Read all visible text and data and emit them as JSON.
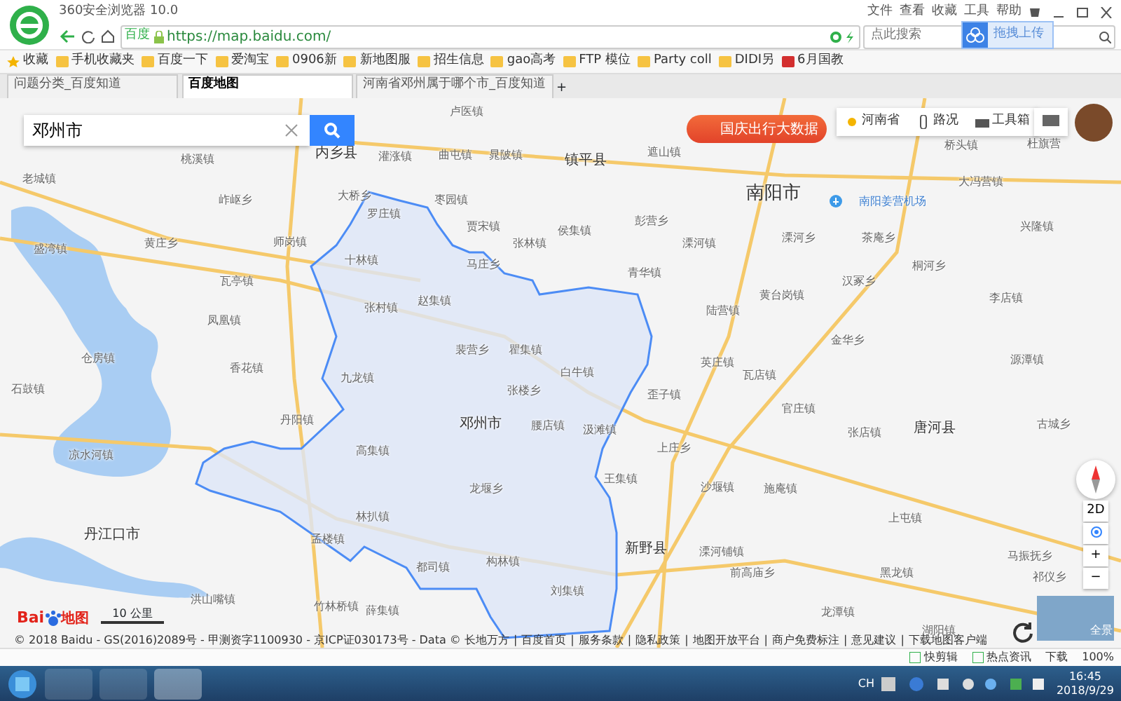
{
  "window": {
    "title": "360安全浏览器 10.0",
    "menu": [
      "文件",
      "查看",
      "收藏",
      "工具",
      "帮助"
    ]
  },
  "address_bar": {
    "site_badge": "百度",
    "url": "https://map.baidu.com/",
    "search_placeholder": "点此搜索",
    "upload_button": "拖拽上传"
  },
  "bookmarks": [
    "收藏",
    "手机收藏夹",
    "百度一下",
    "爱淘宝",
    "0906新",
    "新地图服",
    "招生信息",
    "gao高考",
    "FTP 模位",
    "Party coll",
    "DIDI另",
    "6月国教"
  ],
  "tabs": [
    {
      "label": "问题分类_百度知道",
      "selected": false
    },
    {
      "label": "百度地图",
      "selected": true
    },
    {
      "label": "河南省邓州属于哪个市_百度知道",
      "selected": false
    }
  ],
  "new_tab": "+",
  "map": {
    "search": {
      "value": "邓州市"
    },
    "banner": "国庆出行大数据",
    "toolbar": [
      "河南省",
      "路况",
      "工具箱"
    ],
    "labels": [
      {
        "text": "卢医镇",
        "kind": "town"
      },
      {
        "text": "内乡县",
        "kind": "county"
      },
      {
        "text": "桃溪镇",
        "kind": "town"
      },
      {
        "text": "灌涨镇",
        "kind": "town"
      },
      {
        "text": "曲屯镇",
        "kind": "town"
      },
      {
        "text": "晁陂镇",
        "kind": "town"
      },
      {
        "text": "老城镇",
        "kind": "town"
      },
      {
        "text": "岞岖乡",
        "kind": "town"
      },
      {
        "text": "大桥乡",
        "kind": "town"
      },
      {
        "text": "枣园镇",
        "kind": "town"
      },
      {
        "text": "罗庄镇",
        "kind": "town"
      },
      {
        "text": "贾宋镇",
        "kind": "town"
      },
      {
        "text": "盛湾镇",
        "kind": "town"
      },
      {
        "text": "黄庄乡",
        "kind": "town"
      },
      {
        "text": "师岗镇",
        "kind": "town"
      },
      {
        "text": "张林镇",
        "kind": "town"
      },
      {
        "text": "十林镇",
        "kind": "town"
      },
      {
        "text": "马庄乡",
        "kind": "town"
      },
      {
        "text": "瓦亭镇",
        "kind": "town"
      },
      {
        "text": "赵集镇",
        "kind": "town"
      },
      {
        "text": "张村镇",
        "kind": "town"
      },
      {
        "text": "凤凰镇",
        "kind": "town"
      },
      {
        "text": "裴营乡",
        "kind": "town"
      },
      {
        "text": "瞿集镇",
        "kind": "town"
      },
      {
        "text": "仓房镇",
        "kind": "town"
      },
      {
        "text": "香花镇",
        "kind": "town"
      },
      {
        "text": "九龙镇",
        "kind": "town"
      },
      {
        "text": "镇平县",
        "kind": "county"
      },
      {
        "text": "遮山镇",
        "kind": "town"
      },
      {
        "text": "南阳市",
        "kind": "city"
      },
      {
        "text": "桥头镇",
        "kind": "town"
      },
      {
        "text": "杜旗营",
        "kind": "town"
      },
      {
        "text": "大冯营镇",
        "kind": "town"
      },
      {
        "text": "彭营乡",
        "kind": "town"
      },
      {
        "text": "侯集镇",
        "kind": "town"
      },
      {
        "text": "溧河镇",
        "kind": "town"
      },
      {
        "text": "溧河乡",
        "kind": "town"
      },
      {
        "text": "茶庵乡",
        "kind": "town"
      },
      {
        "text": "兴隆镇",
        "kind": "town"
      },
      {
        "text": "青华镇",
        "kind": "town"
      },
      {
        "text": "桐河乡",
        "kind": "town"
      },
      {
        "text": "汉冢乡",
        "kind": "town"
      },
      {
        "text": "黄台岗镇",
        "kind": "town"
      },
      {
        "text": "陆营镇",
        "kind": "town"
      },
      {
        "text": "李店镇",
        "kind": "town"
      },
      {
        "text": "金华乡",
        "kind": "town"
      },
      {
        "text": "英庄镇",
        "kind": "town"
      },
      {
        "text": "源潭镇",
        "kind": "town"
      },
      {
        "text": "白牛镇",
        "kind": "town"
      },
      {
        "text": "瓦店镇",
        "kind": "town"
      },
      {
        "text": "石鼓镇",
        "kind": "town"
      },
      {
        "text": "张楼乡",
        "kind": "town"
      },
      {
        "text": "歪子镇",
        "kind": "town"
      },
      {
        "text": "丹阳镇",
        "kind": "town"
      },
      {
        "text": "邓州市",
        "kind": "county"
      },
      {
        "text": "腰店镇",
        "kind": "town"
      },
      {
        "text": "汲滩镇",
        "kind": "town"
      },
      {
        "text": "官庄镇",
        "kind": "town"
      },
      {
        "text": "张店镇",
        "kind": "town"
      },
      {
        "text": "唐河县",
        "kind": "county"
      },
      {
        "text": "古城乡",
        "kind": "town"
      },
      {
        "text": "凉水河镇",
        "kind": "town"
      },
      {
        "text": "高集镇",
        "kind": "town"
      },
      {
        "text": "上庄乡",
        "kind": "town"
      },
      {
        "text": "王集镇",
        "kind": "town"
      },
      {
        "text": "龙堰乡",
        "kind": "town"
      },
      {
        "text": "沙堰镇",
        "kind": "town"
      },
      {
        "text": "施庵镇",
        "kind": "town"
      },
      {
        "text": "上屯镇",
        "kind": "town"
      },
      {
        "text": "丹江口市",
        "kind": "county"
      },
      {
        "text": "林扒镇",
        "kind": "town"
      },
      {
        "text": "孟楼镇",
        "kind": "town"
      },
      {
        "text": "新野县",
        "kind": "county"
      },
      {
        "text": "溧河铺镇",
        "kind": "town"
      },
      {
        "text": "马振抚乡",
        "kind": "town"
      },
      {
        "text": "都司镇",
        "kind": "town"
      },
      {
        "text": "构林镇",
        "kind": "town"
      },
      {
        "text": "前高庙乡",
        "kind": "town"
      },
      {
        "text": "黑龙镇",
        "kind": "town"
      },
      {
        "text": "祁仪乡",
        "kind": "town"
      },
      {
        "text": "刘集镇",
        "kind": "town"
      },
      {
        "text": "洪山嘴镇",
        "kind": "town"
      },
      {
        "text": "竹林桥镇",
        "kind": "town"
      },
      {
        "text": "薛集镇",
        "kind": "town"
      },
      {
        "text": "龙潭镇",
        "kind": "town"
      },
      {
        "text": "湖阳镇",
        "kind": "town"
      }
    ],
    "airport": "南阳姜营机场",
    "controls": {
      "mode": "2D",
      "zoom_in": "+",
      "zoom_out": "−"
    },
    "logo": {
      "latin": "Bai",
      "chinese": "地图"
    },
    "scale": "10 公里",
    "street_view": "全景",
    "copyright": "© 2018 Baidu - GS(2016)2089号 - 甲测资字1100930 - 京ICP证030173号 - Data © 长地万方",
    "separator": "|",
    "links": [
      "百度首页",
      "服务条款",
      "隐私政策",
      "地图开放平台",
      "商户免费标注",
      "意见建议",
      "下载地图客户端"
    ]
  },
  "status_bar": {
    "items": [
      "快剪辑",
      "热点资讯"
    ],
    "download": "下载",
    "zoom": "100%"
  },
  "taskbar": {
    "language": "CH",
    "time": "16:45",
    "date": "2018/9/29"
  }
}
